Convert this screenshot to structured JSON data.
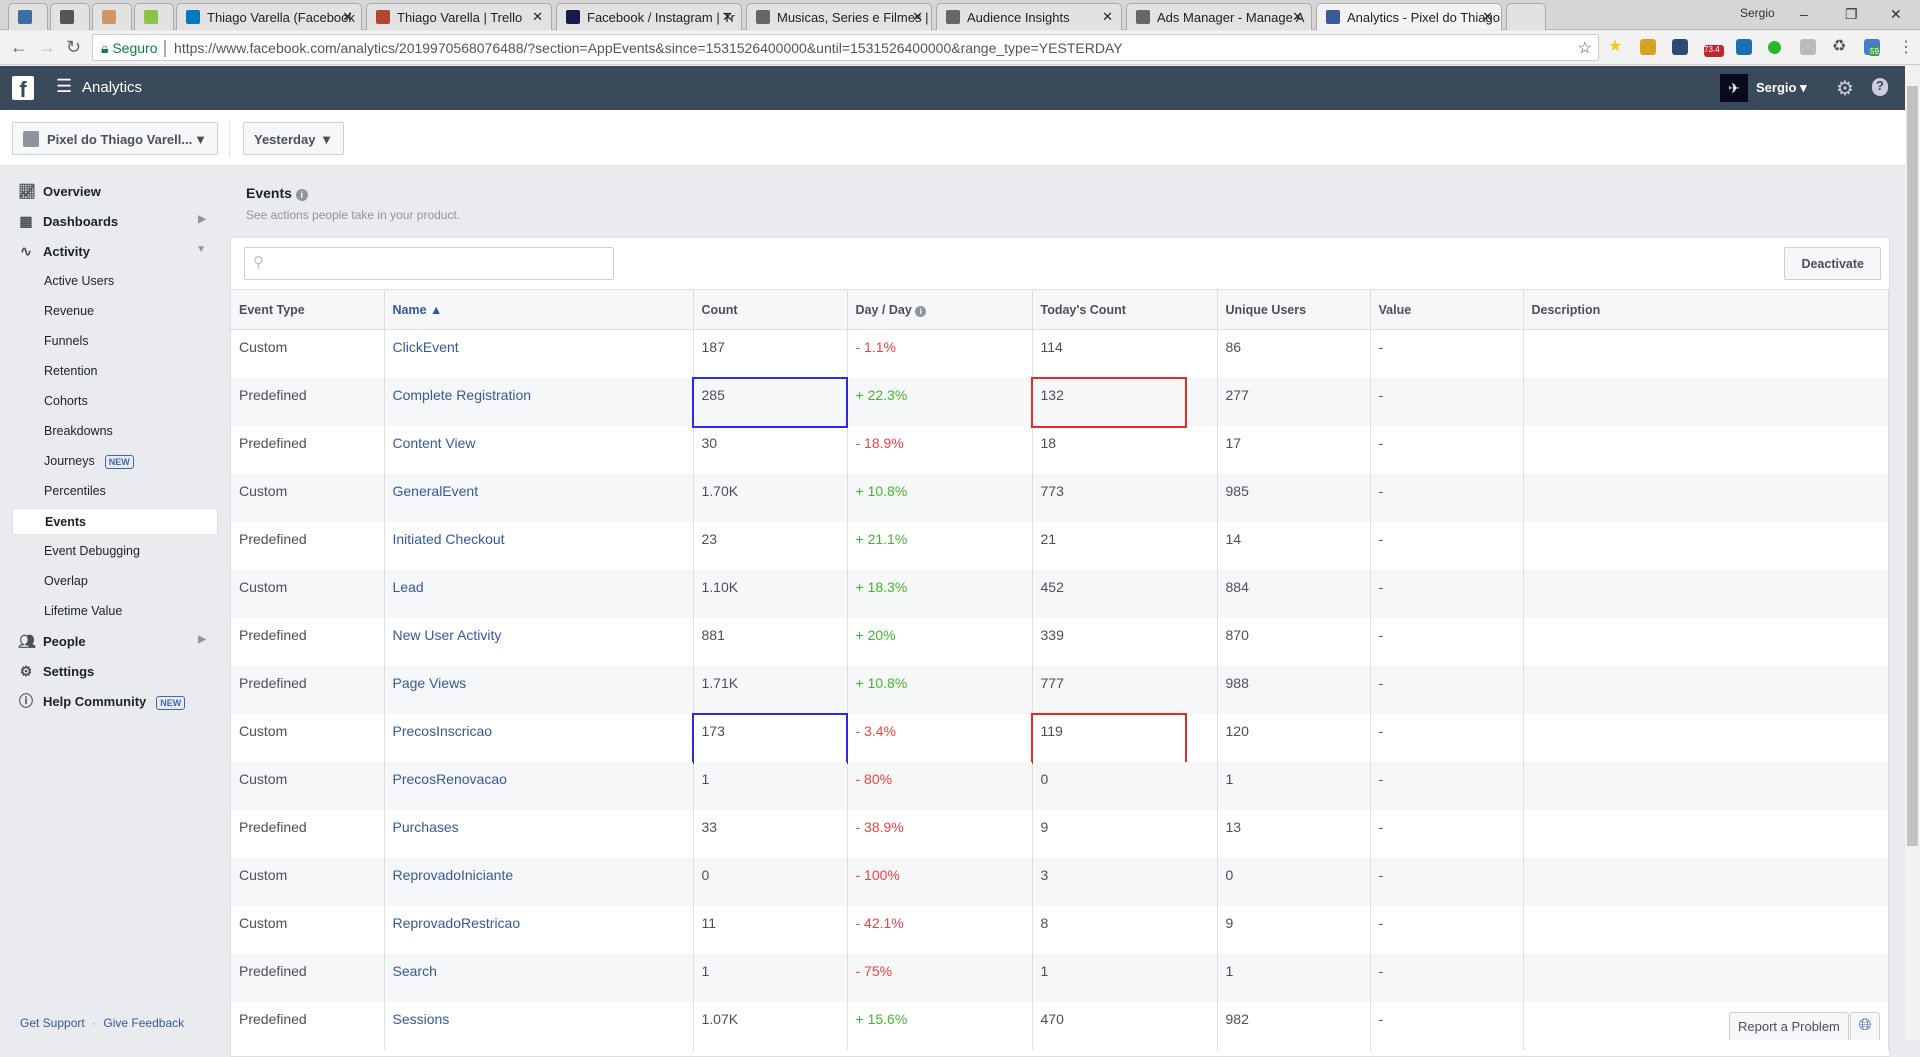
{
  "browser": {
    "tabs": [
      {
        "title": "",
        "color": "#3a6ea5"
      },
      {
        "title": "",
        "color": "#555"
      },
      {
        "title": "",
        "color": "#c96"
      },
      {
        "title": "",
        "color": "#8bc34a"
      },
      {
        "title": "Thiago Varella (Facebook",
        "color": "#0079bf"
      },
      {
        "title": "Thiago Varella | Trello",
        "color": "#b04632"
      },
      {
        "title": "Facebook / Instagram | Tr",
        "color": "#1a1a4a"
      },
      {
        "title": "Musicas, Series e Filmes |",
        "color": "#666"
      },
      {
        "title": "Audience Insights",
        "color": "#666"
      },
      {
        "title": "Ads Manager - Manage A",
        "color": "#666"
      },
      {
        "title": "Analytics - Pixel do Thiago",
        "color": "#3b5998"
      }
    ],
    "profile": "Sergio",
    "url_secure": "Seguro",
    "url": "https://www.facebook.com/analytics/2019970568076488/?section=AppEvents&since=1531526400000&until=1531526400000&range_type=YESTERDAY",
    "ext_badges": [
      "73.4",
      "59"
    ]
  },
  "header": {
    "title": "Analytics",
    "user": "Sergio"
  },
  "filters": {
    "pixel": "Pixel do Thiago Varell...",
    "range": "Yesterday"
  },
  "sidebar": {
    "items": [
      {
        "label": "Overview",
        "type": "top",
        "icon": "chart-icon"
      },
      {
        "label": "Dashboards",
        "type": "top",
        "icon": "grid-icon",
        "chevron": "right"
      },
      {
        "label": "Activity",
        "type": "top",
        "icon": "pulse-icon",
        "chevron": "down"
      },
      {
        "label": "Active Users",
        "type": "sub"
      },
      {
        "label": "Revenue",
        "type": "sub"
      },
      {
        "label": "Funnels",
        "type": "sub"
      },
      {
        "label": "Retention",
        "type": "sub"
      },
      {
        "label": "Cohorts",
        "type": "sub"
      },
      {
        "label": "Breakdowns",
        "type": "sub"
      },
      {
        "label": "Journeys",
        "type": "sub",
        "badge": "NEW"
      },
      {
        "label": "Percentiles",
        "type": "sub"
      },
      {
        "label": "Events",
        "type": "sub",
        "selected": true
      },
      {
        "label": "Event Debugging",
        "type": "sub"
      },
      {
        "label": "Overlap",
        "type": "sub"
      },
      {
        "label": "Lifetime Value",
        "type": "sub"
      },
      {
        "label": "People",
        "type": "top",
        "icon": "people-icon",
        "chevron": "right"
      },
      {
        "label": "Settings",
        "type": "top",
        "icon": "gear-icon"
      },
      {
        "label": "Help Community",
        "type": "top",
        "icon": "help-icon",
        "badge": "NEW"
      }
    ],
    "footer": {
      "support": "Get Support",
      "sep": "·",
      "feedback": "Give Feedback"
    }
  },
  "events": {
    "title": "Events",
    "subtitle": "See actions people take in your product.",
    "search_placeholder": "",
    "deactivate": "Deactivate",
    "columns": [
      "Event Type",
      "Name ▲",
      "Count",
      "Day / Day",
      "Today's Count",
      "Unique Users",
      "Value",
      "Description"
    ],
    "rows": [
      [
        "Custom",
        "ClickEvent",
        "187",
        "- 1.1%",
        "114",
        "86",
        "-",
        ""
      ],
      [
        "Predefined",
        "Complete Registration",
        "285",
        "+ 22.3%",
        "132",
        "277",
        "-",
        ""
      ],
      [
        "Predefined",
        "Content View",
        "30",
        "- 18.9%",
        "18",
        "17",
        "-",
        ""
      ],
      [
        "Custom",
        "GeneralEvent",
        "1.70K",
        "+ 10.8%",
        "773",
        "985",
        "-",
        ""
      ],
      [
        "Predefined",
        "Initiated Checkout",
        "23",
        "+ 21.1%",
        "21",
        "14",
        "-",
        ""
      ],
      [
        "Custom",
        "Lead",
        "1.10K",
        "+ 18.3%",
        "452",
        "884",
        "-",
        ""
      ],
      [
        "Predefined",
        "New User Activity",
        "881",
        "+ 20%",
        "339",
        "870",
        "-",
        ""
      ],
      [
        "Predefined",
        "Page Views",
        "1.71K",
        "+ 10.8%",
        "777",
        "988",
        "-",
        ""
      ],
      [
        "Custom",
        "PrecosInscricao",
        "173",
        "- 3.4%",
        "119",
        "120",
        "-",
        ""
      ],
      [
        "Custom",
        "PrecosRenovacao",
        "1",
        "- 80%",
        "0",
        "1",
        "-",
        ""
      ],
      [
        "Predefined",
        "Purchases",
        "33",
        "- 38.9%",
        "9",
        "13",
        "-",
        ""
      ],
      [
        "Custom",
        "ReprovadoIniciante",
        "0",
        "- 100%",
        "3",
        "0",
        "-",
        ""
      ],
      [
        "Custom",
        "ReprovadoRestricao",
        "11",
        "- 42.1%",
        "8",
        "9",
        "-",
        ""
      ],
      [
        "Predefined",
        "Search",
        "1",
        "- 75%",
        "1",
        "1",
        "-",
        ""
      ],
      [
        "Predefined",
        "Sessions",
        "1.07K",
        "+ 15.6%",
        "470",
        "982",
        "-",
        ""
      ]
    ],
    "highlighted_rows": [
      1,
      8
    ],
    "highlight_colors": {
      "count": "#2a2ae8",
      "today": "#e82a2a"
    }
  },
  "report_problem": "Report a Problem",
  "colors": {
    "header": "#3b4a5a",
    "link": "#365899",
    "negative": "#fa3e3e",
    "positive": "#42b72a"
  }
}
